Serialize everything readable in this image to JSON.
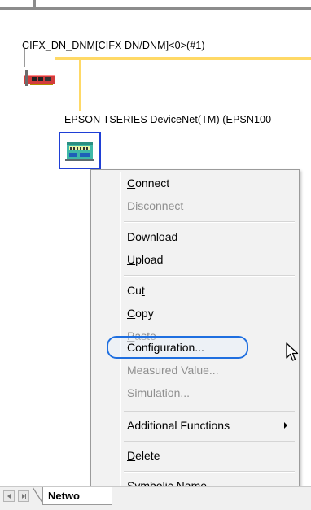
{
  "network": {
    "master_label": "CIFX_DN_DNM[CIFX DN/DNM]<0>(#1)",
    "slave_label": "EPSON TSERIES DeviceNet(TM) (EPSN100",
    "bus_color": "#ffd966",
    "selection_color": "#1f3fd6"
  },
  "context_menu": {
    "items": [
      {
        "label": "Connect",
        "mnemonic": "C",
        "rest": "onnect",
        "enabled": true
      },
      {
        "label": "Disconnect",
        "mnemonic": "D",
        "rest": "isconnect",
        "enabled": false
      },
      {
        "label": "Download",
        "pre": "D",
        "mnemonic": "o",
        "rest": "wnload",
        "enabled": true
      },
      {
        "label": "Upload",
        "mnemonic": "U",
        "rest": "pload",
        "enabled": true
      },
      {
        "label": "Cut",
        "pre": "Cu",
        "mnemonic": "t",
        "rest": "",
        "enabled": true
      },
      {
        "label": "Copy",
        "mnemonic": "C",
        "rest": "opy",
        "enabled": true
      },
      {
        "label": "Paste",
        "mnemonic": "P",
        "rest": "aste",
        "enabled": false
      },
      {
        "label": "Configuration...",
        "enabled": true,
        "highlighted": true
      },
      {
        "label": "Measured Value...",
        "enabled": false
      },
      {
        "label": "Simulation...",
        "enabled": false
      },
      {
        "label": "Additional Functions",
        "enabled": true,
        "submenu": true
      },
      {
        "label": "Delete",
        "mnemonic": "D",
        "rest": "elete",
        "enabled": true
      },
      {
        "label": "Symbolic Name...",
        "enabled": true
      }
    ],
    "highlight_color": "#1f6fe0"
  },
  "tabs": {
    "active_label": "Netwo"
  },
  "icons": {
    "master": "network-card-icon",
    "slave": "devicenet-device-icon",
    "cursor": "mouse-pointer-icon",
    "submenu": "submenu-arrow-icon"
  }
}
